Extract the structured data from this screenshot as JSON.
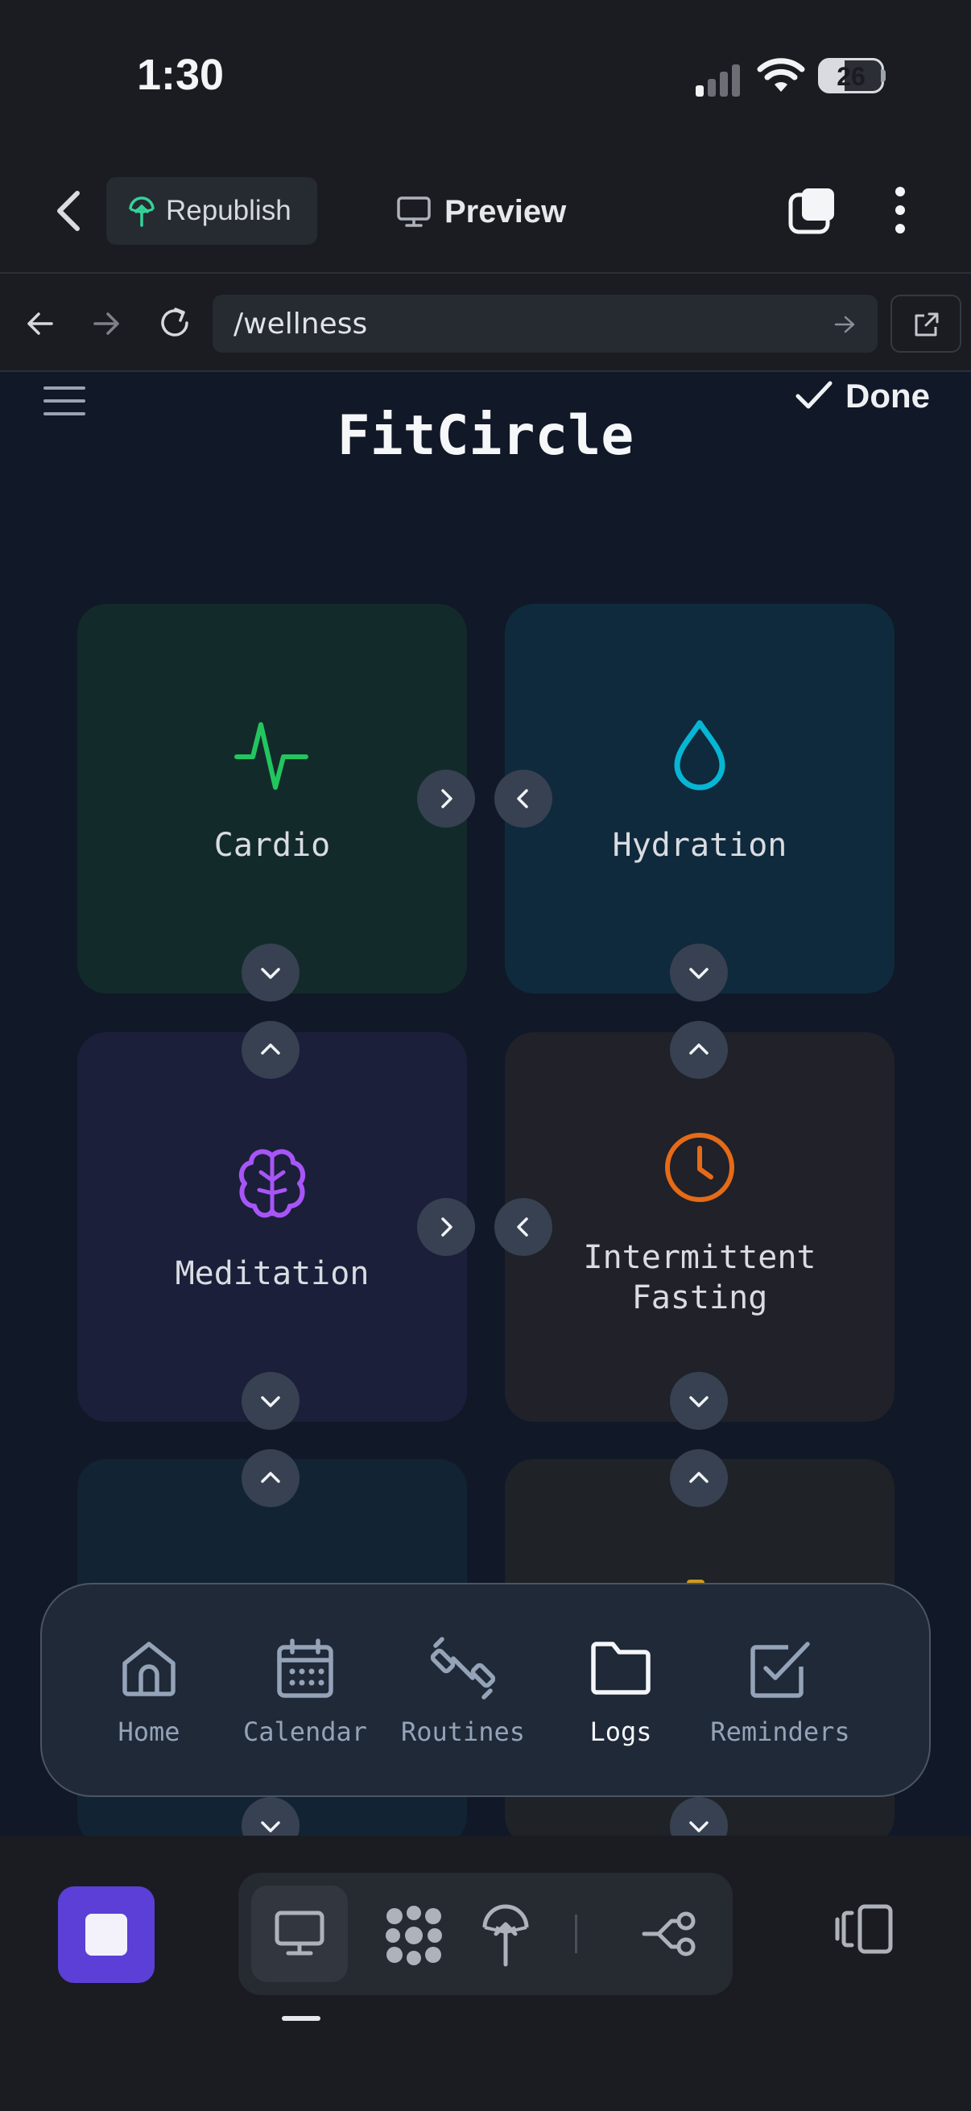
{
  "status_bar": {
    "time": "1:30",
    "battery": "26"
  },
  "editor_header": {
    "republish_label": "Republish",
    "preview_label": "Preview"
  },
  "browser": {
    "url": "/wellness"
  },
  "app": {
    "title": "FitCircle",
    "done_label": "Done",
    "cards": [
      {
        "label": "Cardio",
        "icon": "activity-icon",
        "color": "#22c55e",
        "bg": "#132a2b"
      },
      {
        "label": "Hydration",
        "icon": "droplet-icon",
        "color": "#06b6d4",
        "bg": "#0f2a3c"
      },
      {
        "label": "Meditation",
        "icon": "brain-icon",
        "color": "#a855f7",
        "bg": "#1b1f3a"
      },
      {
        "label_line1": "Intermittent",
        "label_line2": "Fasting",
        "icon": "clock-icon",
        "color": "#f97316",
        "bg": "#202129"
      }
    ],
    "nav": [
      {
        "label": "Home",
        "icon": "home-icon"
      },
      {
        "label": "Calendar",
        "icon": "calendar-icon"
      },
      {
        "label": "Routines",
        "icon": "dumbbell-icon"
      },
      {
        "label": "Logs",
        "icon": "folder-icon",
        "active": true
      },
      {
        "label": "Reminders",
        "icon": "checkbox-icon"
      }
    ]
  },
  "colors": {
    "accent": "#5b3fd6",
    "app_bg": "#111827",
    "chrome_bg": "#1a1c22",
    "republish_green": "#34d399"
  }
}
